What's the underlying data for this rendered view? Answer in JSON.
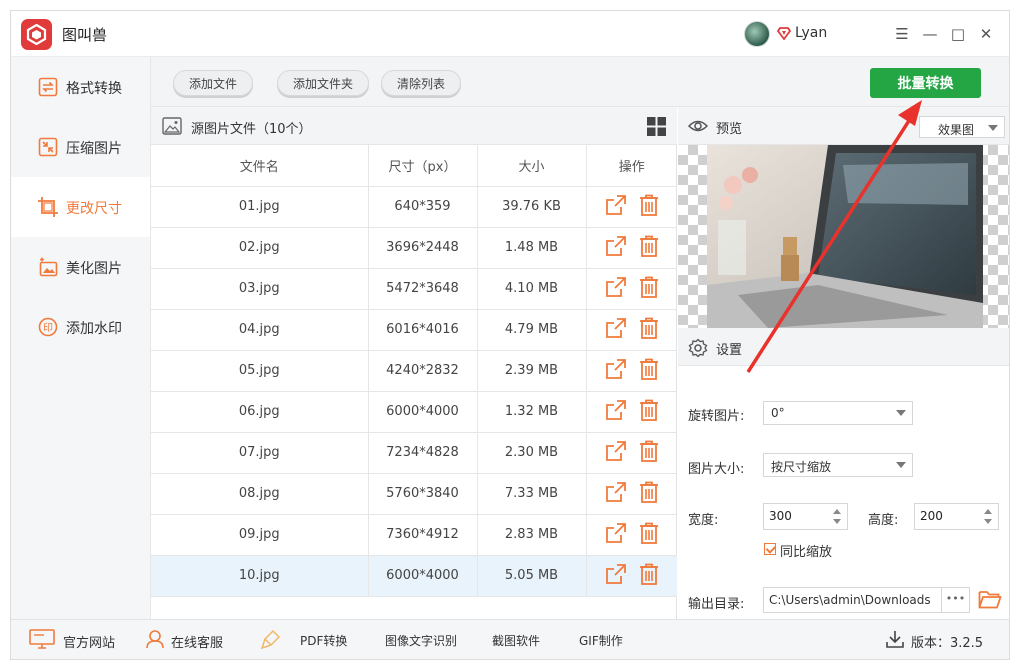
{
  "app": {
    "title": "图叫兽",
    "user_name": "Lyan"
  },
  "window_controls": {
    "menu": "☰",
    "minimize": "—",
    "maximize": "□",
    "close": "✕"
  },
  "sidebar": {
    "items": [
      {
        "label": "格式转换",
        "icon": "format-convert-icon",
        "active": false
      },
      {
        "label": "压缩图片",
        "icon": "compress-icon",
        "active": false
      },
      {
        "label": "更改尺寸",
        "icon": "resize-icon",
        "active": true
      },
      {
        "label": "美化图片",
        "icon": "beautify-icon",
        "active": false
      },
      {
        "label": "添加水印",
        "icon": "watermark-icon",
        "active": false
      }
    ]
  },
  "toolbar": {
    "add_file": "添加文件",
    "add_folder": "添加文件夹",
    "clear_list": "清除列表",
    "batch_convert": "批量转换"
  },
  "file_list": {
    "title": "源图片文件（10个）",
    "columns": [
      "文件名",
      "尺寸（px）",
      "大小",
      "操作"
    ],
    "rows": [
      {
        "name": "01.jpg",
        "dims": "640*359",
        "size": "39.76 KB"
      },
      {
        "name": "02.jpg",
        "dims": "3696*2448",
        "size": "1.48 MB"
      },
      {
        "name": "03.jpg",
        "dims": "5472*3648",
        "size": "4.10 MB"
      },
      {
        "name": "04.jpg",
        "dims": "6016*4016",
        "size": "4.79 MB"
      },
      {
        "name": "05.jpg",
        "dims": "4240*2832",
        "size": "2.39 MB"
      },
      {
        "name": "06.jpg",
        "dims": "6000*4000",
        "size": "1.32 MB"
      },
      {
        "name": "07.jpg",
        "dims": "7234*4828",
        "size": "2.30 MB"
      },
      {
        "name": "08.jpg",
        "dims": "5760*3840",
        "size": "7.33 MB"
      },
      {
        "name": "09.jpg",
        "dims": "7360*4912",
        "size": "2.83 MB"
      },
      {
        "name": "10.jpg",
        "dims": "6000*4000",
        "size": "5.05 MB"
      }
    ],
    "selected_row": "10.jpg"
  },
  "preview": {
    "title": "预览",
    "mode_value": "效果图"
  },
  "settings": {
    "title": "设置",
    "rotate_label": "旋转图片:",
    "rotate_value": "0°",
    "size_label": "图片大小:",
    "size_value": "按尺寸缩放",
    "width_label": "宽度:",
    "width_value": "300",
    "height_label": "高度:",
    "height_value": "200",
    "keep_ratio_label": "同比缩放",
    "keep_ratio_checked": true,
    "output_label": "输出目录:",
    "output_path": "C:\\Users\\admin\\Downloads",
    "more_button": "•••"
  },
  "statusbar": {
    "official_site": "官方网站",
    "online_service": "在线客服",
    "pdf_convert": "PDF转换",
    "ocr": "图像文字识别",
    "screenshot": "截图软件",
    "gif": "GIF制作",
    "version": "版本：3.2.5"
  },
  "colors": {
    "accent_orange": "#f07a3c",
    "batch_green": "#24a645",
    "arrow_red": "#e8322b",
    "logo_red": "#e03a3a"
  }
}
